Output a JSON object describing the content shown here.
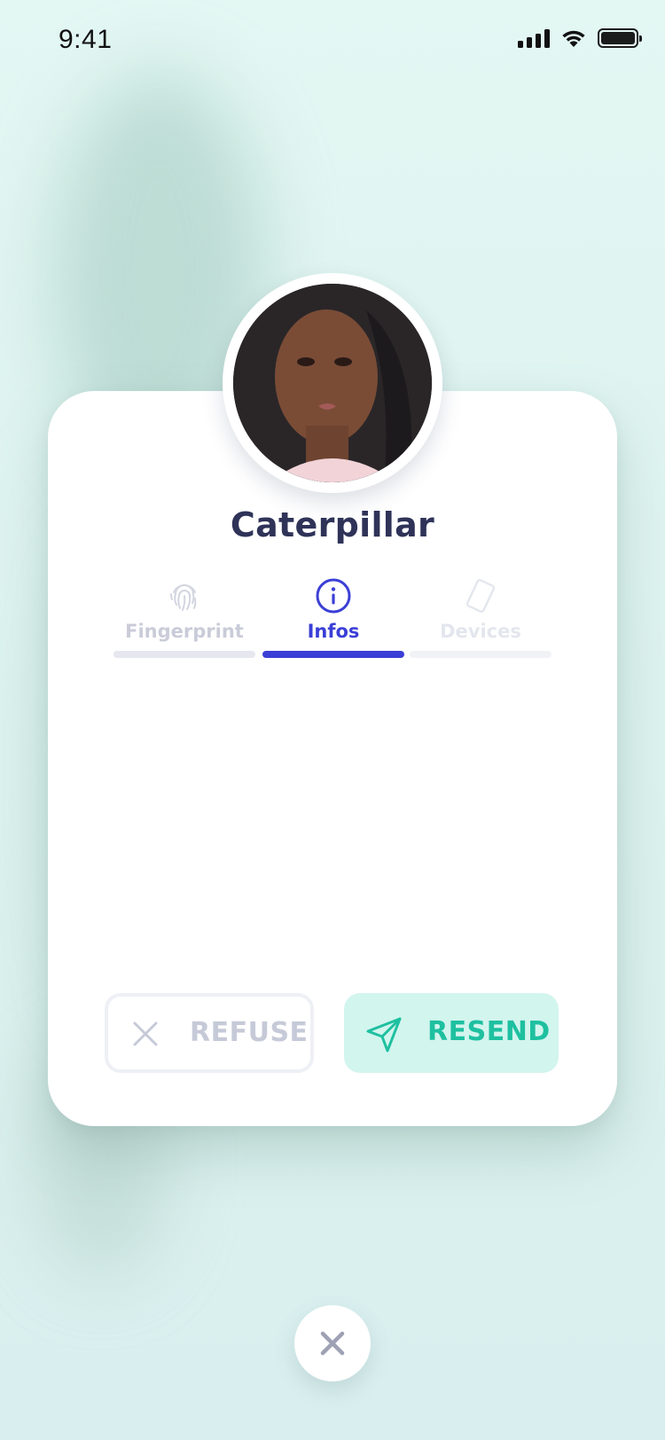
{
  "status_bar": {
    "time": "9:41"
  },
  "profile": {
    "name": "Caterpillar"
  },
  "tabs": [
    {
      "label": "Fingerprint",
      "icon": "fingerprint-icon",
      "active": false
    },
    {
      "label": "Infos",
      "icon": "info-icon",
      "active": true
    },
    {
      "label": "Devices",
      "icon": "device-icon",
      "active": false
    }
  ],
  "actions": {
    "refuse_label": "REFUSE",
    "resend_label": "RESEND"
  },
  "colors": {
    "accent": "#3b3fd6",
    "resend_text": "#1ec0a0",
    "resend_bg": "#d2f5ee",
    "name_text": "#2f3358"
  }
}
